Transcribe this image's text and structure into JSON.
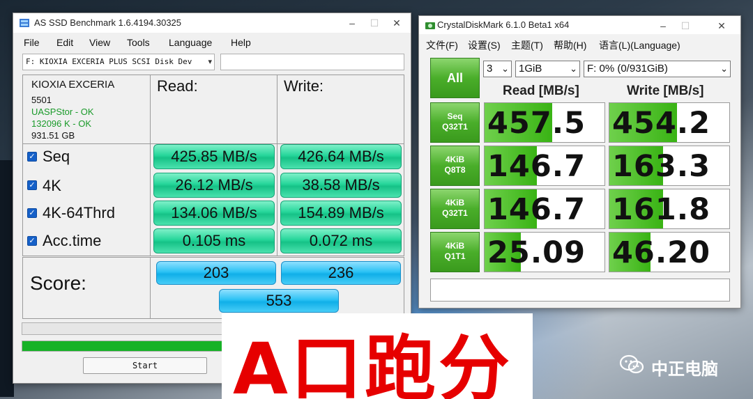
{
  "asssd": {
    "title": "AS SSD Benchmark 1.6.4194.30325",
    "menu": [
      "File",
      "Edit",
      "View",
      "Tools",
      "Language",
      "Help"
    ],
    "device": "F: KIOXIA EXCERIA PLUS SCSI Disk Dev",
    "info": {
      "name": "KIOXIA EXCERIA",
      "firmware": "5501",
      "driver": "UASPStor - OK",
      "alignment": "132096 K - OK",
      "size": "931.51 GB"
    },
    "headers": {
      "read": "Read:",
      "write": "Write:"
    },
    "rows": [
      {
        "label": "Seq",
        "read": "425.85 MB/s",
        "write": "426.64 MB/s"
      },
      {
        "label": "4K",
        "read": "26.12 MB/s",
        "write": "38.58 MB/s"
      },
      {
        "label": "4K-64Thrd",
        "read": "134.06 MB/s",
        "write": "154.89 MB/s"
      },
      {
        "label": "Acc.time",
        "read": "0.105 ms",
        "write": "0.072 ms"
      }
    ],
    "score_label": "Score:",
    "score_read": "203",
    "score_write": "236",
    "score_total": "553",
    "progress_text": "-:--",
    "progress_fraction": 0.6,
    "start_label": "Start"
  },
  "cdm": {
    "title": "CrystalDiskMark 6.1.0 Beta1 x64",
    "menu": [
      "文件(F)",
      "设置(S)",
      "主题(T)",
      "帮助(H)",
      "语言(L)(Language)"
    ],
    "all_label": "All",
    "count": "3",
    "size": "1GiB",
    "drive": "F: 0% (0/931GiB)",
    "read_header": "Read [MB/s]",
    "write_header": "Write [MB/s]",
    "tests": [
      {
        "l1": "Seq",
        "l2": "Q32T1",
        "read": "457.5",
        "write": "454.2",
        "read_frac": 0.56,
        "write_frac": 0.56
      },
      {
        "l1": "4KiB",
        "l2": "Q8T8",
        "read": "146.7",
        "write": "163.3",
        "read_frac": 0.43,
        "write_frac": 0.44
      },
      {
        "l1": "4KiB",
        "l2": "Q32T1",
        "read": "146.7",
        "write": "161.8",
        "read_frac": 0.43,
        "write_frac": 0.44
      },
      {
        "l1": "4KiB",
        "l2": "Q1T1",
        "read": "25.09",
        "write": "46.20",
        "read_frac": 0.3,
        "write_frac": 0.34
      }
    ]
  },
  "caption": "A口跑分",
  "watermark": "中正电脑",
  "colors": {
    "red": "#e60000",
    "green": "#17b227",
    "blue": "#10afe8"
  }
}
